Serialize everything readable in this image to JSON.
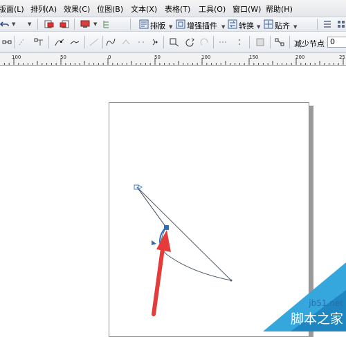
{
  "menu": [
    {
      "label": "版面(L)"
    },
    {
      "label": "排列(A)"
    },
    {
      "label": "效果(C)"
    },
    {
      "label": "位图(B)"
    },
    {
      "label": "文本(X)"
    },
    {
      "label": "表格(T)"
    },
    {
      "label": "工具(O)"
    },
    {
      "label": "窗口(W)"
    },
    {
      "label": "帮助(H)"
    }
  ],
  "toolbar": {
    "layout_label": "排版",
    "enhance_plugin_label": "增强插件",
    "convert_label": "转换",
    "align_label": "贴齐"
  },
  "property_bar": {
    "reduce_nodes_label": "减少节点",
    "reduce_nodes_value": "0"
  },
  "ruler": {
    "labels": [
      "100",
      "50",
      "0",
      "50",
      "100",
      "150",
      "200",
      "25"
    ]
  },
  "watermark": {
    "site": "jb51.net",
    "name": "脚本之家"
  },
  "colors": {
    "accent": "#2e6fb7",
    "arrow": "#e53b3b",
    "watermark": "#35a7dc"
  }
}
